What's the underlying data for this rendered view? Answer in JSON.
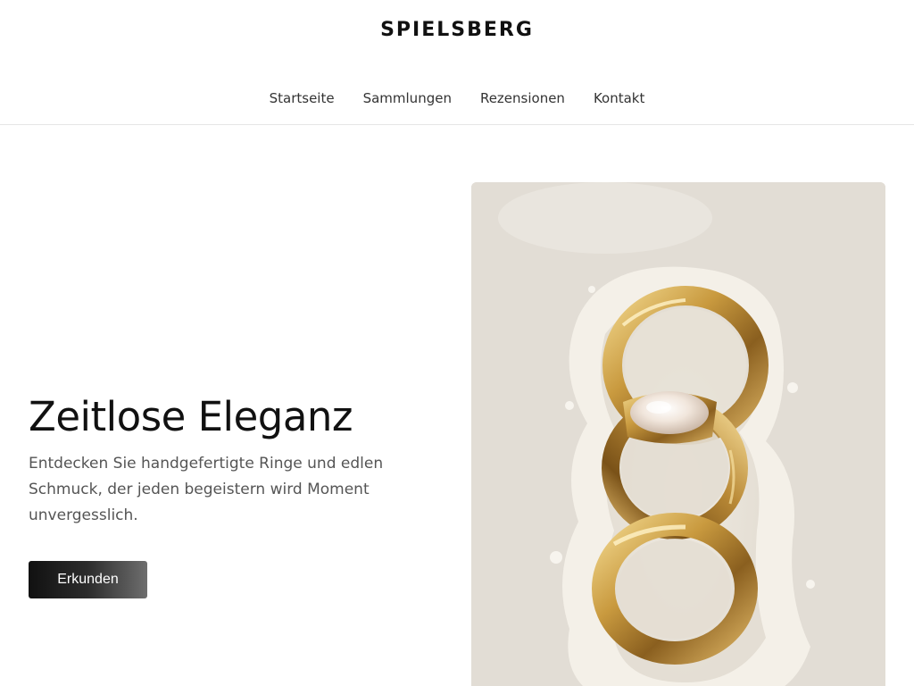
{
  "brand": {
    "name": "SPIELSBERG"
  },
  "nav": {
    "items": [
      {
        "label": "Startseite"
      },
      {
        "label": "Sammlungen"
      },
      {
        "label": "Rezensionen"
      },
      {
        "label": "Kontakt"
      }
    ]
  },
  "hero": {
    "title": "Zeitlose Eleganz",
    "description": "Entdecken Sie handgefertigte Ringe und edlen Schmuck, der jeden begeistern wird Moment unvergesslich.",
    "cta_label": "Erkunden",
    "image_alt_icon": "gold-rings-image"
  },
  "colors": {
    "text_primary": "#111111",
    "text_secondary": "#555555",
    "button_dark": "#111111",
    "gold": "#c9a04a",
    "powder": "#f3efe7"
  }
}
